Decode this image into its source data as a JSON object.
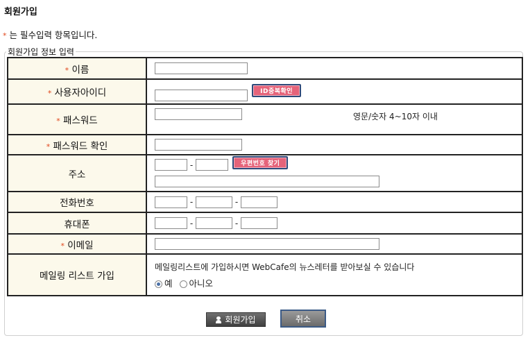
{
  "page": {
    "title": "회원가입"
  },
  "required_note": {
    "star": "*",
    "text": "는 필수입력 항목입니다."
  },
  "section": {
    "legend": "회원가입 정보 입력"
  },
  "fields": {
    "name": {
      "label": "이름",
      "required": true
    },
    "userid": {
      "label": "사용자아이디",
      "required": true,
      "check_button": "ID중복확인"
    },
    "password": {
      "label": "패스워드",
      "required": true,
      "hint": "영문/숫자 4~10자 이내"
    },
    "password_confirm": {
      "label": "패스워드 확인",
      "required": true
    },
    "address": {
      "label": "주소",
      "required": false,
      "zip_dash": "-",
      "zip_button": "우편번호 찾기"
    },
    "phone": {
      "label": "전화번호",
      "required": false,
      "dash": "-"
    },
    "mobile": {
      "label": "휴대폰",
      "required": false,
      "dash": "-"
    },
    "email": {
      "label": "이메일",
      "required": true
    },
    "mailing": {
      "label": "메일링 리스트 가입",
      "description": "메일링리스트에 가입하시면 WebCafe의 뉴스레터를 받아보실 수 있습니다",
      "options": [
        "예",
        "아니오"
      ],
      "selected": "예"
    }
  },
  "buttons": {
    "join": "회원가입",
    "cancel": "취소"
  },
  "colors": {
    "label_bg": "#fcf9eb",
    "required_star": "#e0461b",
    "pink_button": "#e5637a"
  }
}
